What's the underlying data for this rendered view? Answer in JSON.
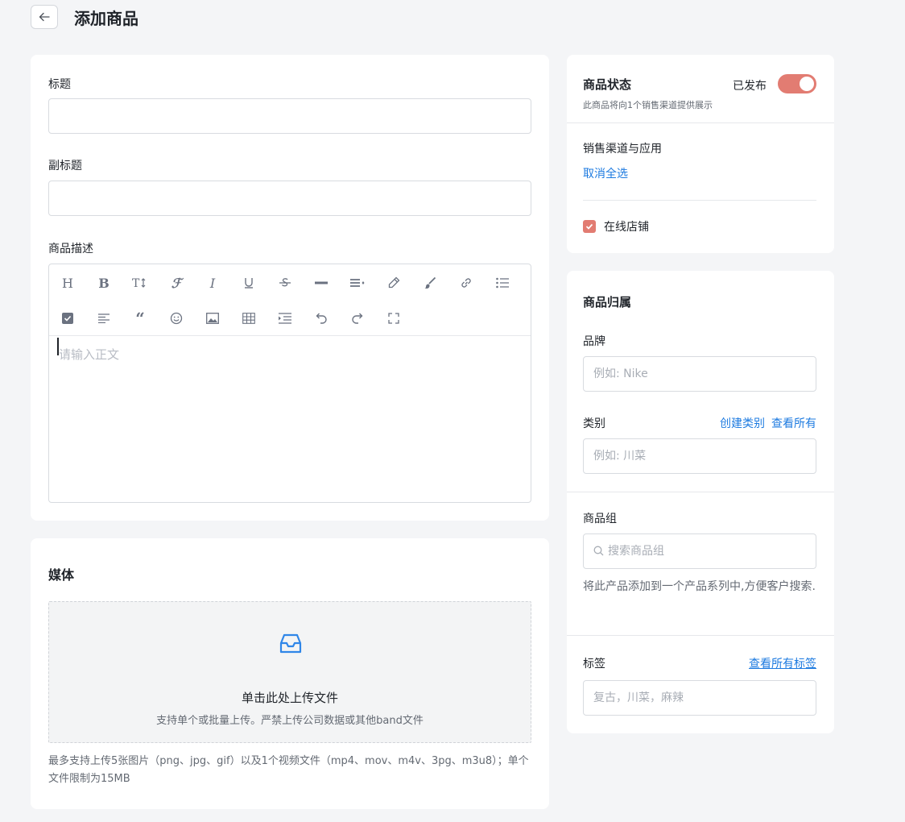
{
  "header": {
    "title": "添加商品"
  },
  "main": {
    "title_label": "标题",
    "title_value": "",
    "subtitle_label": "副标题",
    "subtitle_value": "",
    "description_label": "商品描述",
    "toolbar_row1": [
      "heading",
      "bold",
      "font-size",
      "font-family",
      "italic",
      "underline",
      "strikethrough",
      "horizontal-rule",
      "line-height",
      "highlight",
      "brush",
      "link",
      "bulleted-list"
    ],
    "toolbar_row2": [
      "checkbox",
      "align-left",
      "quote",
      "emoji",
      "image",
      "table",
      "indent",
      "undo",
      "redo",
      "fullscreen"
    ],
    "editor_placeholder": "请输入正文"
  },
  "media": {
    "title": "媒体",
    "upload_title": "单击此处上传文件",
    "upload_subtitle": "支持单个或批量上传。严禁上传公司数据或其他band文件",
    "note": "最多支持上传5张图片（png、jpg、gif）以及1个视频文件（mp4、mov、m4v、3pg、m3u8）；单个文件限制为15MB"
  },
  "status": {
    "title": "商品状态",
    "subtitle": "此商品将向1个销售渠道提供展示",
    "published_label": "已发布",
    "published": true,
    "channels_label": "销售渠道与应用",
    "deselect_all": "取消全选",
    "online_store_label": "在线店铺",
    "online_store_checked": true
  },
  "ownership": {
    "title": "商品归属",
    "brand_label": "品牌",
    "brand_placeholder": "例如: Nike",
    "category_label": "类别",
    "create_category": "创建类别",
    "view_all": "查看所有",
    "category_placeholder": "例如: 川菜",
    "group_label": "商品组",
    "group_placeholder": "搜索商品组",
    "group_help": "将此产品添加到一个产品系列中,方便客户搜索.",
    "tags_label": "标签",
    "view_all_tags": "查看所有标签",
    "tags_placeholder": "复古，川菜，麻辣"
  },
  "colors": {
    "accent": "#e27c72",
    "link": "#1e7be0",
    "background": "#f4f5f7"
  }
}
